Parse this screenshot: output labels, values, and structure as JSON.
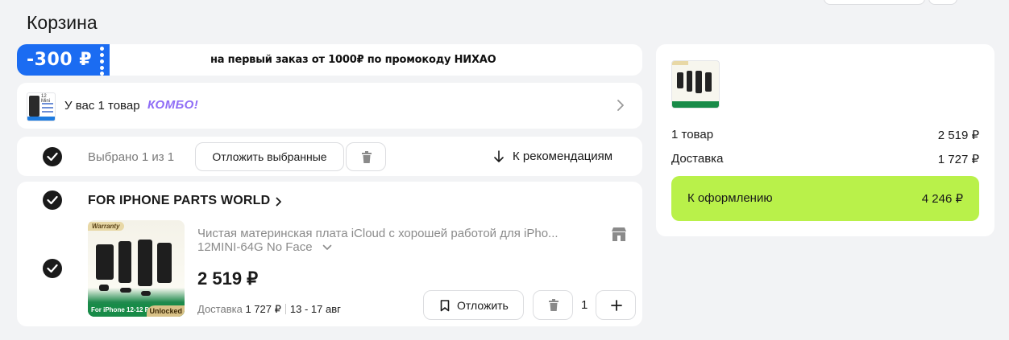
{
  "page": {
    "title": "Корзина"
  },
  "promo": {
    "badge": "-300 ₽",
    "text": "на первый заказ от 1000₽ по промокоду НИХАО"
  },
  "combo": {
    "text": "У вас 1 товар",
    "tag": "КОМБО!",
    "thumb_label": "12 Mini"
  },
  "selection": {
    "status": "Выбрано 1 из 1",
    "defer_selected_label": "Отложить выбранные",
    "recommendations_label": "К рекомендациям"
  },
  "seller": {
    "name": "FOR IPHONE PARTS WORLD"
  },
  "product": {
    "title": "Чистая материнская плата iCloud с хорошей работой для iPho...",
    "variant": "12MINI-64G No Face",
    "price": "2 519 ₽",
    "delivery_label": "Доставка",
    "delivery_price": "1 727 ₽",
    "delivery_dates": "13 - 17 авг",
    "defer_label": "Отложить",
    "quantity": "1",
    "image_warranty": "Warranty",
    "image_footer": "For iPhone 12-12 Pro Max",
    "image_unlocked": "Unlocked"
  },
  "summary": {
    "items_label": "1 товар",
    "items_value": "2 519 ₽",
    "delivery_label": "Доставка",
    "delivery_value": "1 727 ₽",
    "checkout_label": "К оформлению",
    "checkout_total": "4 246 ₽"
  },
  "colors": {
    "promo_blue": "#1b6cf2",
    "combo_purple": "#8f6df6",
    "checkout_green": "#b9f14a"
  },
  "icons": [
    "check-icon",
    "trash-icon",
    "arrow-down-icon",
    "chevron-right-icon",
    "chevron-down-icon",
    "store-icon",
    "bookmark-icon",
    "plus-icon"
  ]
}
